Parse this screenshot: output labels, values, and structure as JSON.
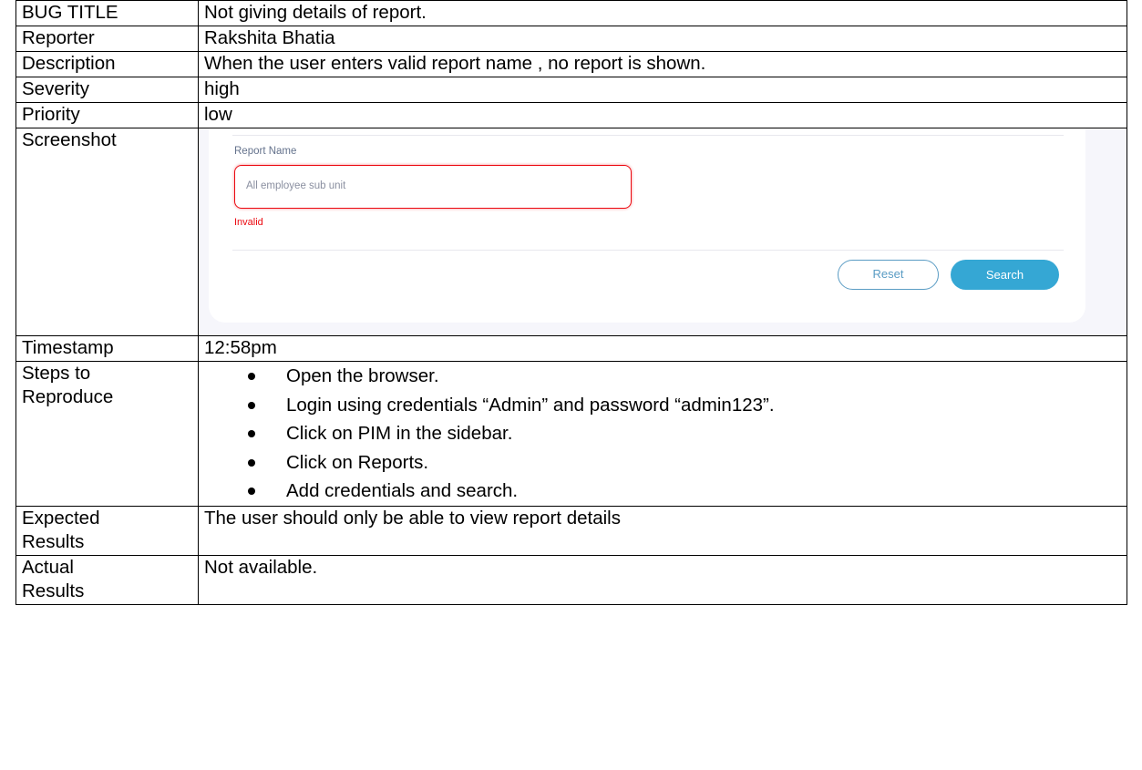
{
  "bug_report": {
    "bug_title": {
      "label": "BUG TITLE",
      "value": "Not giving details of report."
    },
    "reporter": {
      "label": "Reporter",
      "value": "Rakshita Bhatia"
    },
    "description": {
      "label": "Description",
      "value": "When the user enters valid report name , no report is shown."
    },
    "severity": {
      "label": "Severity",
      "value": "high"
    },
    "priority": {
      "label": "Priority",
      "value": "low"
    },
    "screenshot": {
      "label": "Screenshot",
      "report_name_label": "Report Name",
      "input_value": "All employee sub unit",
      "error_text": "Invalid",
      "reset_label": "Reset",
      "search_label": "Search",
      "error_color": "#eb0910",
      "accent_color": "#35a7d4"
    },
    "timestamp": {
      "label": "Timestamp",
      "value": "12:58pm"
    },
    "steps": {
      "label_line1": "Steps to",
      "label_line2": "Reproduce",
      "items": [
        "Open the browser.",
        "Login using credentials “Admin” and password “admin123”.",
        "Click on PIM in the sidebar.",
        "Click on Reports.",
        "Add credentials and search."
      ]
    },
    "expected": {
      "label_line1": "Expected",
      "label_line2": "Results",
      "value": "The user should only be able to view report details"
    },
    "actual": {
      "label_line1": "Actual",
      "label_line2": "Results",
      "value": "Not available."
    }
  }
}
